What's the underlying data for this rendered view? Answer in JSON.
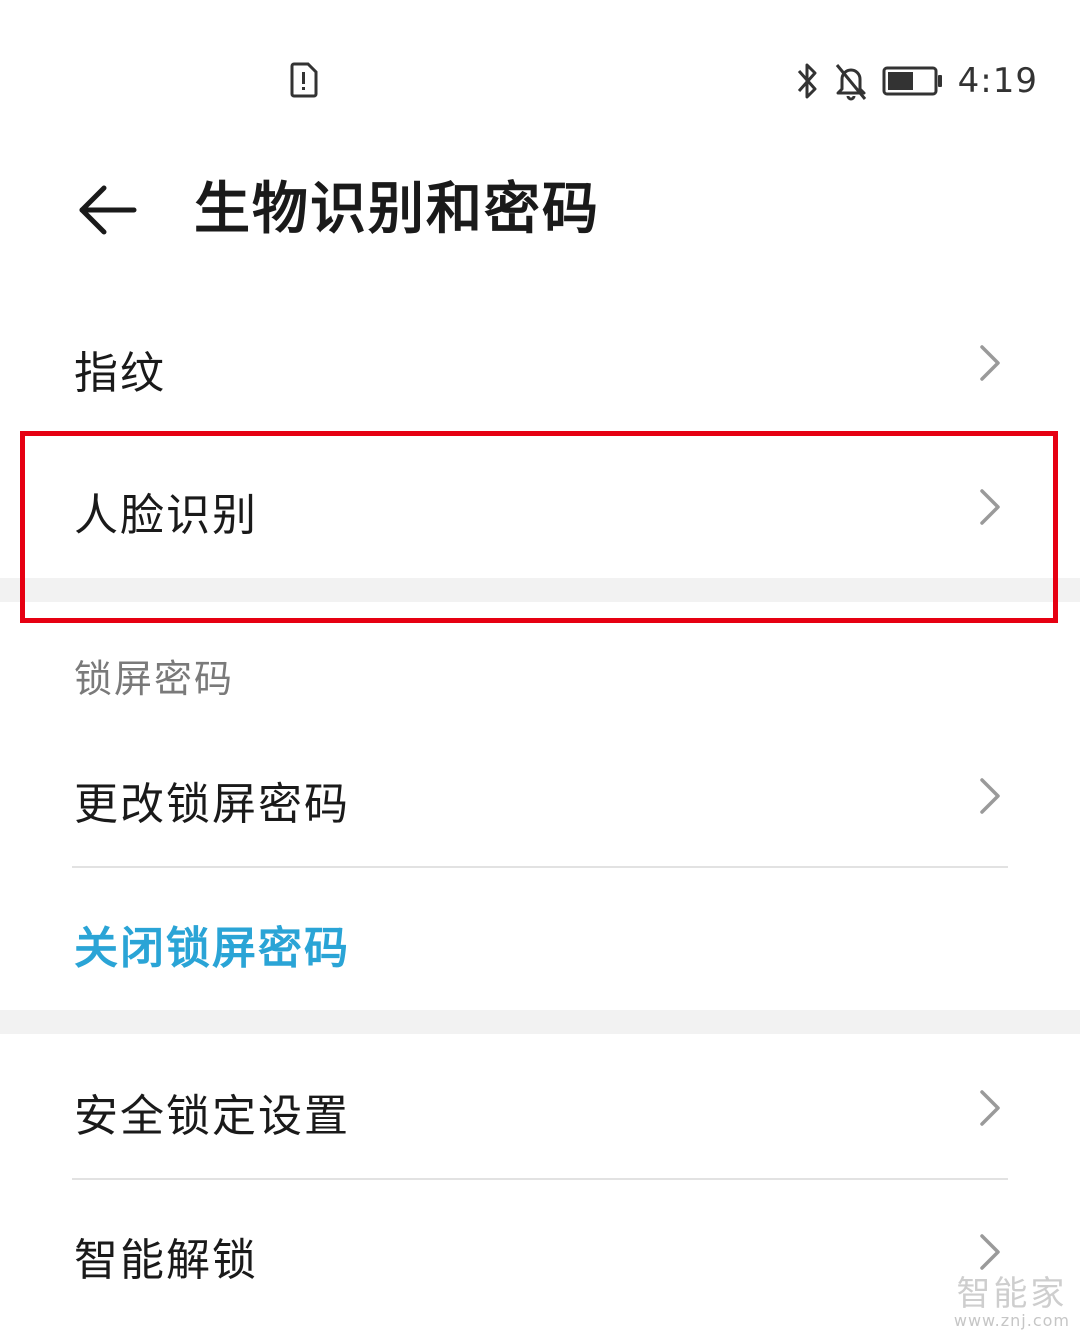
{
  "status_bar": {
    "time": "4:19",
    "icons": [
      "sim-alert-icon",
      "bluetooth-icon",
      "bell-off-icon",
      "battery-icon"
    ]
  },
  "header": {
    "title": "生物识别和密码",
    "back_icon": "arrow-left-icon"
  },
  "rows": {
    "fingerprint": "指纹",
    "face_recognition": "人脸识别",
    "section_lock_screen": "锁屏密码",
    "change_lock_password": "更改锁屏密码",
    "disable_lock_password": "关闭锁屏密码",
    "security_lock_settings": "安全锁定设置",
    "smart_unlock": "智能解锁"
  },
  "watermark": {
    "main": "智能家",
    "sub": "www.znj.com"
  },
  "colors": {
    "accent": "#2aa4d6",
    "highlight": "#e60012",
    "text_primary": "#1a1a1a",
    "text_secondary": "#7a7a7a"
  }
}
